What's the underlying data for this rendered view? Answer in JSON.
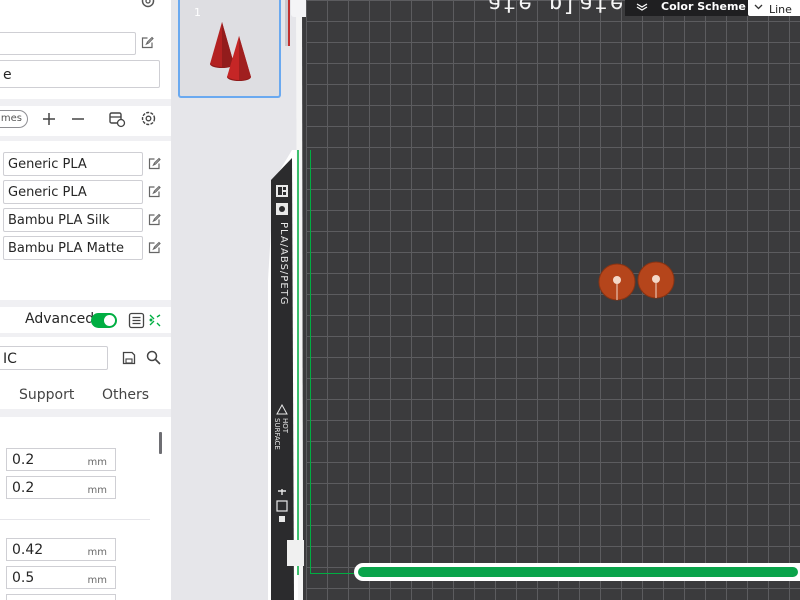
{
  "panel": {
    "name_input_value": "",
    "printer_field_value": "e",
    "filament_tag_label": "mes",
    "filaments": [
      {
        "name": "Generic PLA"
      },
      {
        "name": "Generic PLA"
      },
      {
        "name": "Bambu PLA Silk"
      },
      {
        "name": "Bambu PLA Matte"
      }
    ],
    "advanced_label": "Advanced",
    "process_field_value": "IC",
    "tabs": [
      {
        "label": "Support"
      },
      {
        "label": "Others"
      }
    ],
    "fields": [
      {
        "value": "0.2",
        "unit": "mm"
      },
      {
        "value": "0.2",
        "unit": "mm"
      },
      {
        "value": "0.42",
        "unit": "mm"
      },
      {
        "value": "0.5",
        "unit": "mm"
      }
    ]
  },
  "plate": {
    "thumbnail_number": "1",
    "bed_label": "PLA/ABS/PETG",
    "hot_surface_label": "HOT SURFACE",
    "plate_title": "ate plate"
  },
  "toolbar": {
    "color_scheme_label": "Color Scheme",
    "line_type_value": "Line"
  },
  "colors": {
    "accent": "#00ae42",
    "bed": "#3b3b3d",
    "model": "#b5451b",
    "cone": "#b32121"
  }
}
